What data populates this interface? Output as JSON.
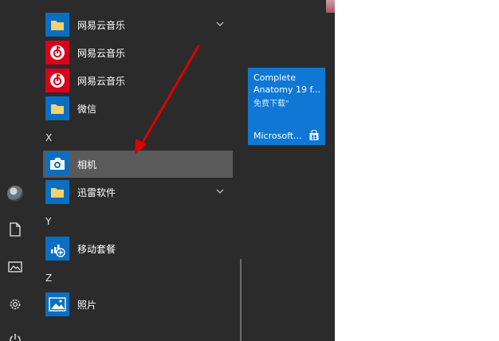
{
  "start_menu": {
    "apps": [
      {
        "label": "网易云音乐",
        "icon": "folder-icon",
        "kind": "folder",
        "expandable": true
      },
      {
        "label": "网易云音乐",
        "icon": "netease-cloud-music-icon",
        "kind": "app"
      },
      {
        "label": "网易云音乐",
        "icon": "netease-cloud-music-icon",
        "kind": "app"
      },
      {
        "label": "微信",
        "icon": "folder-icon",
        "kind": "folder"
      },
      {
        "label": "相机",
        "icon": "camera-icon",
        "kind": "app",
        "highlighted": true
      },
      {
        "label": "迅雷软件",
        "icon": "folder-icon",
        "kind": "folder",
        "expandable": true
      },
      {
        "label": "移动套餐",
        "icon": "mobile-plans-icon",
        "kind": "app"
      },
      {
        "label": "照片",
        "icon": "photos-icon",
        "kind": "app"
      }
    ],
    "section_letters": {
      "x": "X",
      "y": "Y",
      "z": "Z"
    },
    "rail": [
      "user-avatar",
      "document-icon",
      "pictures-icon",
      "gear-icon",
      "power-icon"
    ],
    "live_tile": {
      "title": "Complete Anatomy 19 f...",
      "subtitle": "免费下载\"",
      "publisher": "Microsoft...",
      "icon": "store-bag-icon"
    }
  },
  "annotation": {
    "type": "red-arrow",
    "color": "#e00000",
    "target": "相机"
  },
  "colors": {
    "background": "#2b2b2b",
    "hover": "#5a5a5a",
    "tile": "#0f78d4",
    "accent_blue": "#0a6fc2",
    "netease_red": "#d9001b",
    "folder_yellow": "#f4d26d"
  }
}
